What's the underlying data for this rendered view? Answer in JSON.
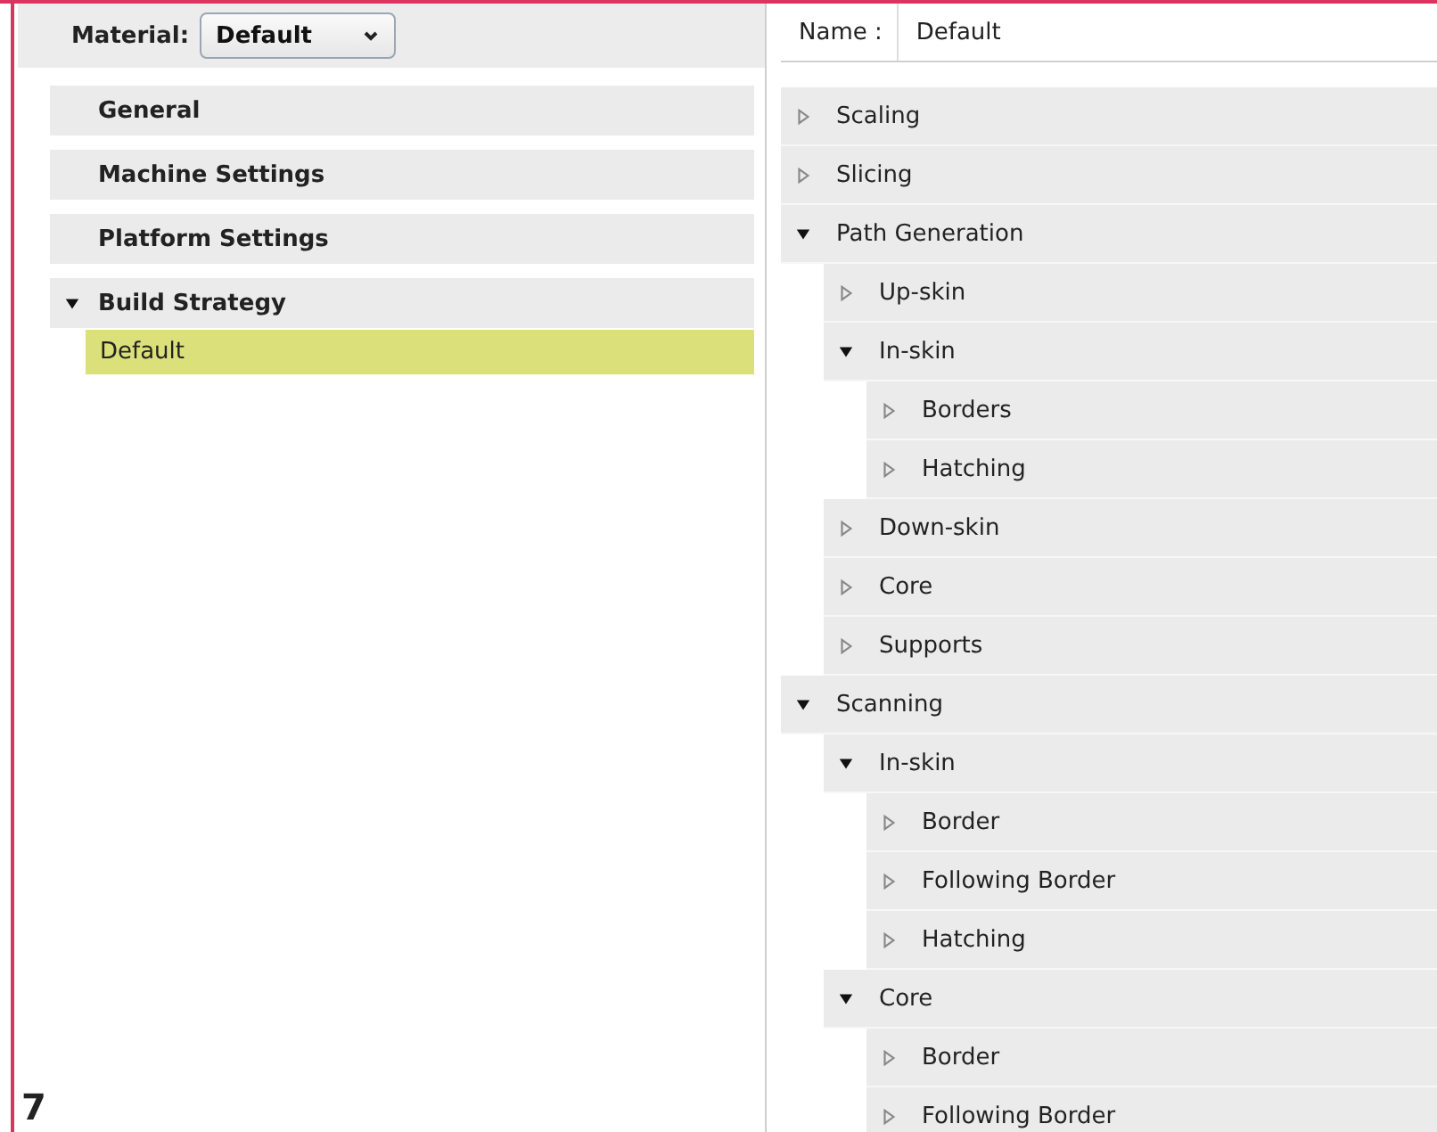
{
  "material": {
    "label": "Material:",
    "value": "Default"
  },
  "sections": [
    {
      "label": "General",
      "expanded": false
    },
    {
      "label": "Machine Settings",
      "expanded": false
    },
    {
      "label": "Platform Settings",
      "expanded": false
    },
    {
      "label": "Build Strategy",
      "expanded": true,
      "children": [
        {
          "label": "Default",
          "selected": true
        }
      ]
    }
  ],
  "name_field": {
    "label": "Name :",
    "value": "Default"
  },
  "tree": [
    {
      "label": "Scaling",
      "expanded": false
    },
    {
      "label": "Slicing",
      "expanded": false
    },
    {
      "label": "Path Generation",
      "expanded": true,
      "children": [
        {
          "label": "Up-skin",
          "expanded": false
        },
        {
          "label": "In-skin",
          "expanded": true,
          "children": [
            {
              "label": "Borders",
              "expanded": false
            },
            {
              "label": "Hatching",
              "expanded": false
            }
          ]
        },
        {
          "label": "Down-skin",
          "expanded": false
        },
        {
          "label": "Core",
          "expanded": false
        },
        {
          "label": "Supports",
          "expanded": false
        }
      ]
    },
    {
      "label": "Scanning",
      "expanded": true,
      "children": [
        {
          "label": "In-skin",
          "expanded": true,
          "children": [
            {
              "label": "Border",
              "expanded": false
            },
            {
              "label": "Following Border",
              "expanded": false
            },
            {
              "label": "Hatching",
              "expanded": false
            }
          ]
        },
        {
          "label": "Core",
          "expanded": true,
          "children": [
            {
              "label": "Border",
              "expanded": false
            },
            {
              "label": "Following Border",
              "expanded": false
            }
          ]
        }
      ]
    }
  ],
  "figure_label": "7"
}
